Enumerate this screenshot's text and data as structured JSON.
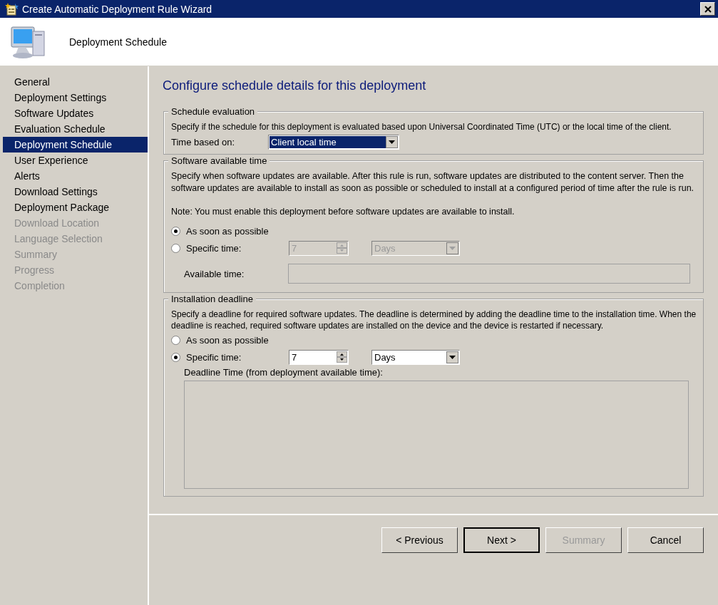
{
  "window": {
    "title": "Create Automatic Deployment Rule Wizard"
  },
  "header": {
    "title": "Deployment Schedule"
  },
  "sidebar": {
    "items": [
      {
        "label": "General",
        "selected": false,
        "disabled": false
      },
      {
        "label": "Deployment Settings",
        "selected": false,
        "disabled": false
      },
      {
        "label": "Software Updates",
        "selected": false,
        "disabled": false
      },
      {
        "label": "Evaluation Schedule",
        "selected": false,
        "disabled": false
      },
      {
        "label": "Deployment Schedule",
        "selected": true,
        "disabled": false
      },
      {
        "label": "User Experience",
        "selected": false,
        "disabled": false
      },
      {
        "label": "Alerts",
        "selected": false,
        "disabled": false
      },
      {
        "label": "Download Settings",
        "selected": false,
        "disabled": false
      },
      {
        "label": "Deployment Package",
        "selected": false,
        "disabled": false
      },
      {
        "label": "Download Location",
        "selected": false,
        "disabled": true
      },
      {
        "label": "Language Selection",
        "selected": false,
        "disabled": true
      },
      {
        "label": "Summary",
        "selected": false,
        "disabled": true
      },
      {
        "label": "Progress",
        "selected": false,
        "disabled": true
      },
      {
        "label": "Completion",
        "selected": false,
        "disabled": true
      }
    ]
  },
  "page_title": "Configure schedule details for this deployment",
  "schedule_evaluation": {
    "legend": "Schedule evaluation",
    "description": "Specify if the schedule for this deployment is evaluated based upon Universal Coordinated Time (UTC) or the local time of the client.",
    "time_based_on": {
      "label": "Time based on:",
      "value": "Client local time"
    }
  },
  "software_available_time": {
    "legend": "Software available time",
    "description": "Specify when software updates are available. After this rule is run, software updates are distributed to the content server. Then the software updates are available to install as soon as possible or scheduled to install at a configured period of time after the rule is run.",
    "note": "Note: You must enable this deployment before software updates are available to install.",
    "options": [
      {
        "label": "As soon as possible",
        "selected": true
      },
      {
        "label": "Specific time:",
        "selected": false
      }
    ],
    "amount": {
      "value": "7",
      "disabled": true
    },
    "unit": {
      "value": "Days",
      "disabled": true
    },
    "available_time": {
      "label": "Available time:"
    }
  },
  "installation_deadline": {
    "legend": "Installation deadline",
    "description": "Specify a deadline for required software updates. The deadline is determined by adding the deadline time to the installation time. When the deadline is reached, required software updates are installed on the device and the device is restarted if necessary.",
    "options": [
      {
        "label": "As soon as possible",
        "selected": false
      },
      {
        "label": "Specific time:",
        "selected": true
      }
    ],
    "amount": {
      "value": "7",
      "disabled": false
    },
    "unit": {
      "value": "Days",
      "disabled": false
    },
    "deadline_time": {
      "label": "Deadline Time (from deployment available time):"
    }
  },
  "buttons": [
    {
      "label": "< Previous",
      "disabled": false,
      "focused": false
    },
    {
      "label": "Next >",
      "disabled": false,
      "focused": true
    },
    {
      "label": "Summary",
      "disabled": true,
      "focused": false
    },
    {
      "label": "Cancel",
      "disabled": false,
      "focused": false
    }
  ]
}
